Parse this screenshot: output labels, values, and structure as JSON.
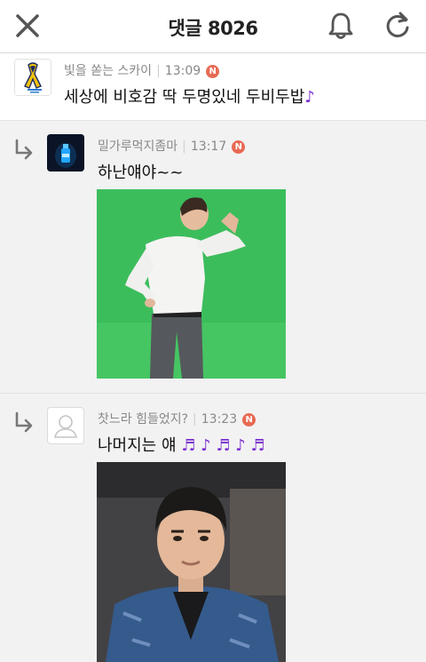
{
  "header": {
    "title": "댓글",
    "count": "8026",
    "close_icon": "close-icon",
    "bell_icon": "bell-icon",
    "refresh_icon": "refresh-icon"
  },
  "comments": [
    {
      "author": "빛을 쏟는 스카이",
      "time": "13:09",
      "badge": "N",
      "text": "세상에 비호감 딱 두명있네 두비두밥",
      "emoji": "♪",
      "is_reply": false,
      "avatar_icon": "yellow-ribbon-logo"
    },
    {
      "author": "밀가루먹지좀마",
      "time": "13:17",
      "badge": "N",
      "text": "하난얘야~~",
      "is_reply": true,
      "avatar_icon": "glowing-bottle-image",
      "image_desc_icon": "photo-man-green-screen"
    },
    {
      "author": "찻느라 힘들었지?",
      "time": "13:23",
      "badge": "N",
      "text": "나머지는 얘",
      "emoji": "♬ ♪ ♬ ♪ ♬",
      "is_reply": true,
      "avatar_icon": "default-user-icon",
      "image_desc_icon": "photo-man-blue-jacket"
    }
  ],
  "colors": {
    "badge": "#e86a54",
    "note": "#7a2fd0",
    "green_screen": "#3dbb5e",
    "reply_bg": "#f2f2f2"
  }
}
